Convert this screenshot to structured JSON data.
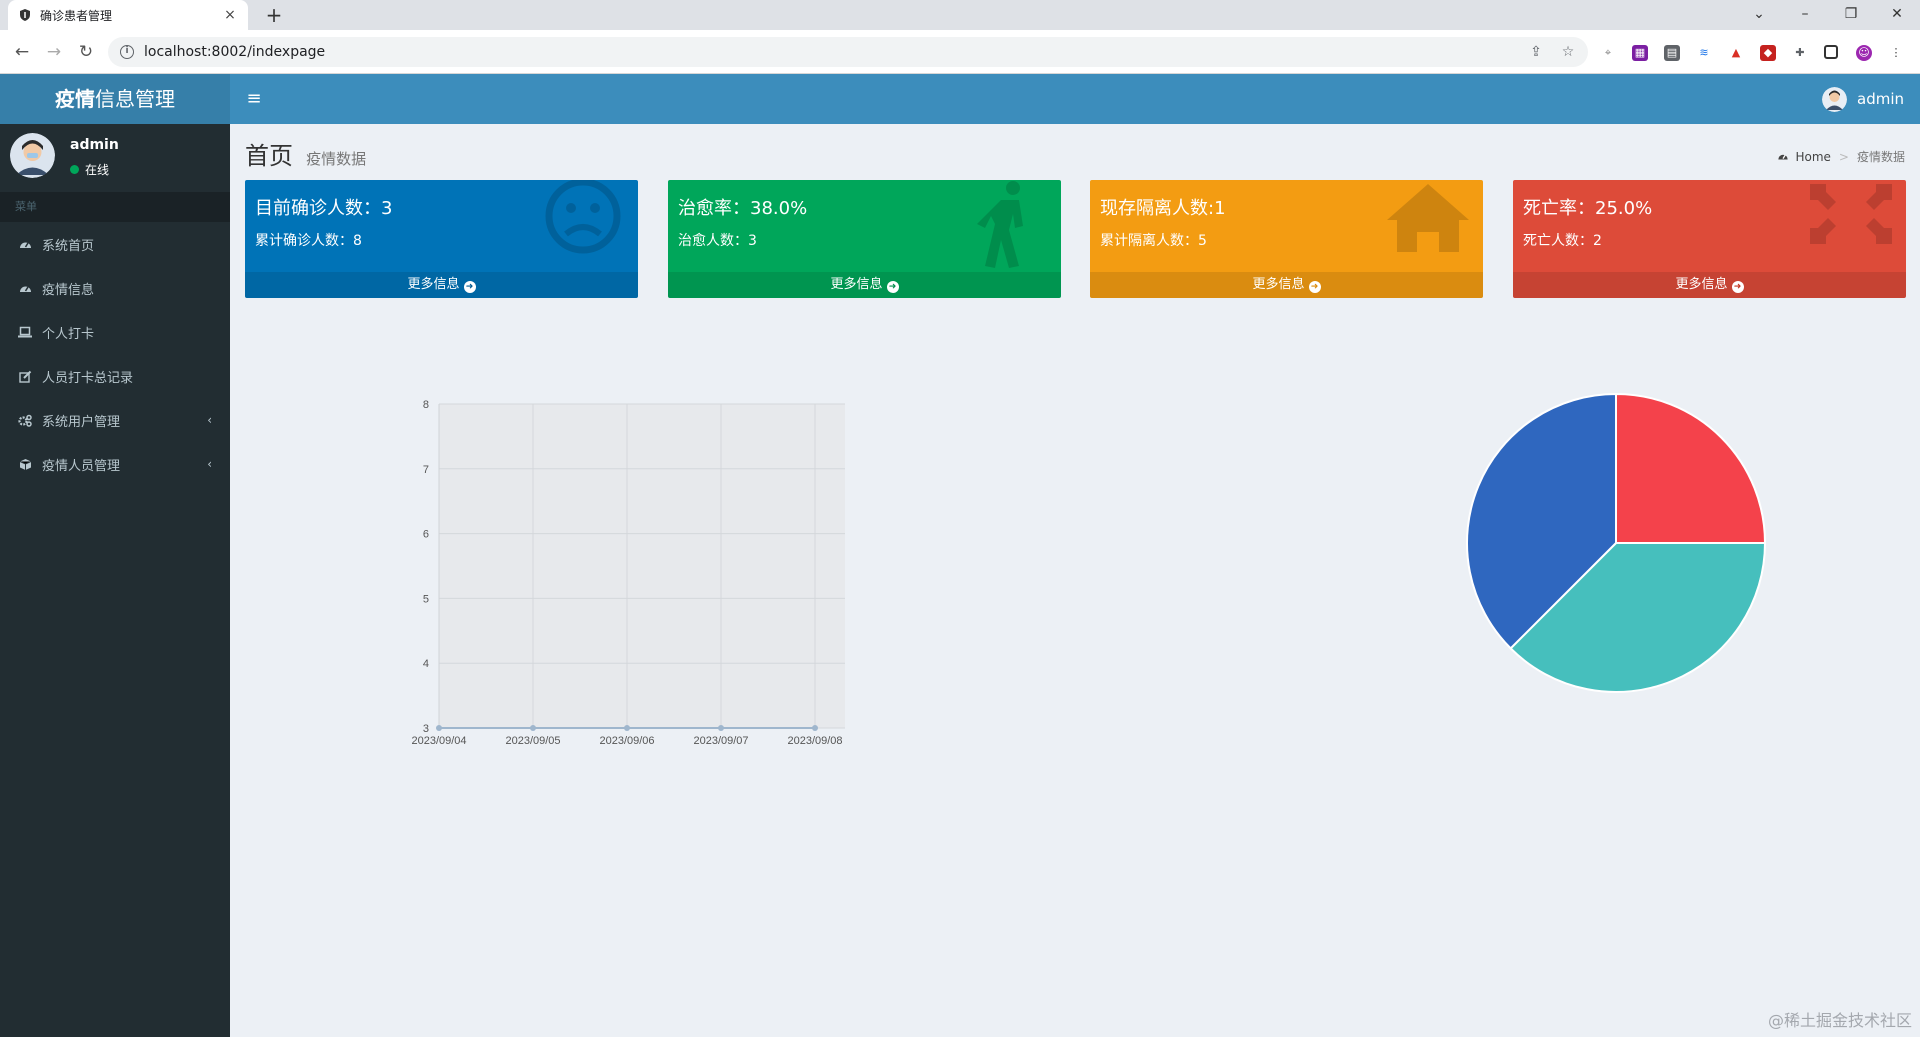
{
  "browser": {
    "tab_title": "确诊患者管理",
    "tab_close": "×",
    "new_tab": "+",
    "url": "localhost:8002/indexpage"
  },
  "header": {
    "logo_bold": "疫情",
    "logo_rest": "信息管理",
    "user": "admin"
  },
  "sidebar": {
    "user_name": "admin",
    "status": "在线",
    "menu_header": "菜单",
    "items": [
      {
        "label": "系统首页",
        "icon": "dashboard-icon"
      },
      {
        "label": "疫情信息",
        "icon": "dashboard-icon"
      },
      {
        "label": "个人打卡",
        "icon": "laptop-icon"
      },
      {
        "label": "人员打卡总记录",
        "icon": "edit-icon"
      },
      {
        "label": "系统用户管理",
        "icon": "cogs-icon",
        "caret": "‹"
      },
      {
        "label": "疫情人员管理",
        "icon": "cube-icon",
        "caret": "‹"
      }
    ]
  },
  "content": {
    "title": "首页",
    "subtitle": "疫情数据",
    "breadcrumb": [
      "Home",
      "疫情数据"
    ],
    "breadcrumb_sep": ">"
  },
  "boxes": [
    {
      "big": "目前确诊人数：3",
      "small": "累计确诊人数：8",
      "footer": "更多信息",
      "color": "#0073b7",
      "icon": "frown-icon"
    },
    {
      "big": "治愈率：38.0%",
      "small": "治愈人数：3",
      "footer": "更多信息",
      "color": "#00a65a",
      "icon": "walking-icon"
    },
    {
      "big": "现存隔离人数:1",
      "small": "累计隔离人数：5",
      "footer": "更多信息",
      "color": "#f39c12",
      "icon": "home-icon"
    },
    {
      "big": "死亡率：25.0%",
      "small": "死亡人数：2",
      "footer": "更多信息",
      "color": "#dd4b39",
      "icon": "compress-icon"
    }
  ],
  "chart_data": [
    {
      "type": "line",
      "x": [
        "2023/09/04",
        "2023/09/05",
        "2023/09/06",
        "2023/09/07",
        "2023/09/08"
      ],
      "series": [
        {
          "values": [
            3,
            3,
            3,
            3,
            3
          ],
          "color": "#9fb6cd"
        }
      ],
      "ylim": [
        3,
        8
      ],
      "yticks": [
        3,
        4,
        5,
        6,
        7,
        8
      ],
      "grid": true
    },
    {
      "type": "pie",
      "slices": [
        {
          "value": 25.0,
          "color": "#f4424b"
        },
        {
          "value": 37.5,
          "color": "#46bfbd"
        },
        {
          "value": 37.5,
          "color": "#2f67bf"
        }
      ]
    }
  ],
  "watermark": "@稀土掘金技术社区"
}
